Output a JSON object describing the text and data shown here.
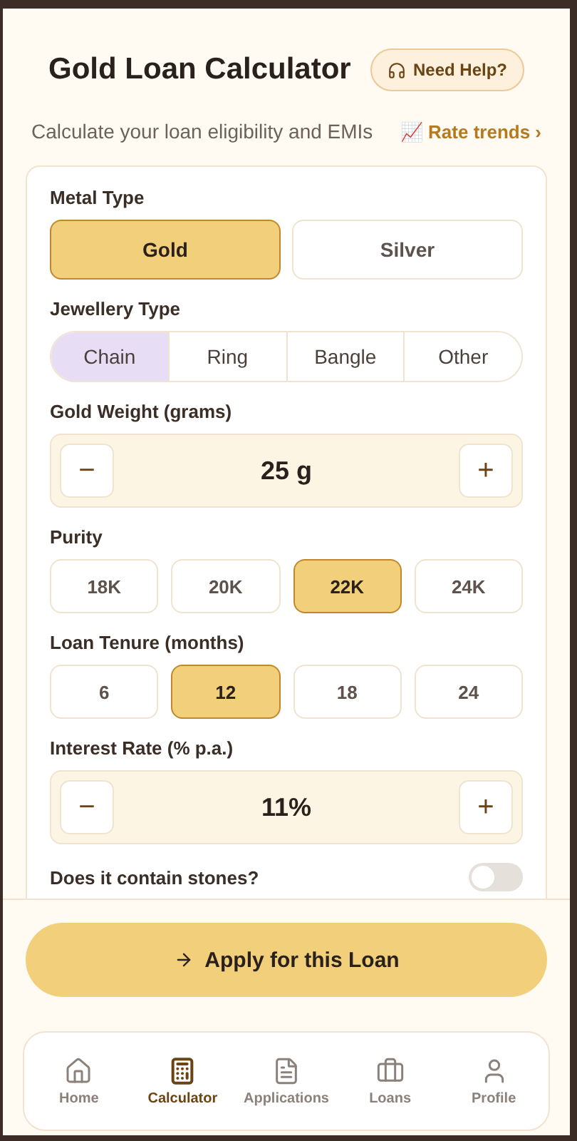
{
  "header": {
    "title": "Gold Loan Calculator",
    "help_button": "Need Help?",
    "subtitle": "Calculate your loan eligibility and EMIs",
    "rate_link": "📈 Rate trends ›"
  },
  "form": {
    "fields": [
      {
        "kind": "pair",
        "label": "Metal Type",
        "options": [
          {
            "label": "Gold",
            "selected": true
          },
          {
            "label": "Silver",
            "selected": false
          }
        ]
      },
      {
        "kind": "segmented",
        "label": "Jewellery Type",
        "options": [
          {
            "label": "Chain",
            "selected": true
          },
          {
            "label": "Ring",
            "selected": false
          },
          {
            "label": "Bangle",
            "selected": false
          },
          {
            "label": "Other",
            "selected": false
          }
        ]
      },
      {
        "kind": "stepper",
        "label": "Gold Weight (grams)",
        "minus": "−",
        "value": "25 g",
        "plus": "+"
      },
      {
        "kind": "choice",
        "label": "Purity",
        "options": [
          {
            "label": "18K",
            "selected": false
          },
          {
            "label": "20K",
            "selected": false
          },
          {
            "label": "22K",
            "selected": true
          },
          {
            "label": "24K",
            "selected": false
          }
        ]
      },
      {
        "kind": "choice",
        "label": "Loan Tenure (months)",
        "options": [
          {
            "label": "6",
            "selected": false
          },
          {
            "label": "12",
            "selected": true
          },
          {
            "label": "18",
            "selected": false
          },
          {
            "label": "24",
            "selected": false
          }
        ]
      },
      {
        "kind": "stepper",
        "label": "Interest Rate (% p.a.)",
        "minus": "−",
        "value": "11%",
        "plus": "+"
      },
      {
        "kind": "toggle",
        "label": "Does it contain stones?",
        "on": false
      }
    ]
  },
  "apply_button": "Apply for this Loan",
  "nav": [
    {
      "label": "Home",
      "selected": false
    },
    {
      "label": "Calculator",
      "selected": true
    },
    {
      "label": "Applications",
      "selected": false
    },
    {
      "label": "Loans",
      "selected": false
    },
    {
      "label": "Profile",
      "selected": false
    }
  ]
}
